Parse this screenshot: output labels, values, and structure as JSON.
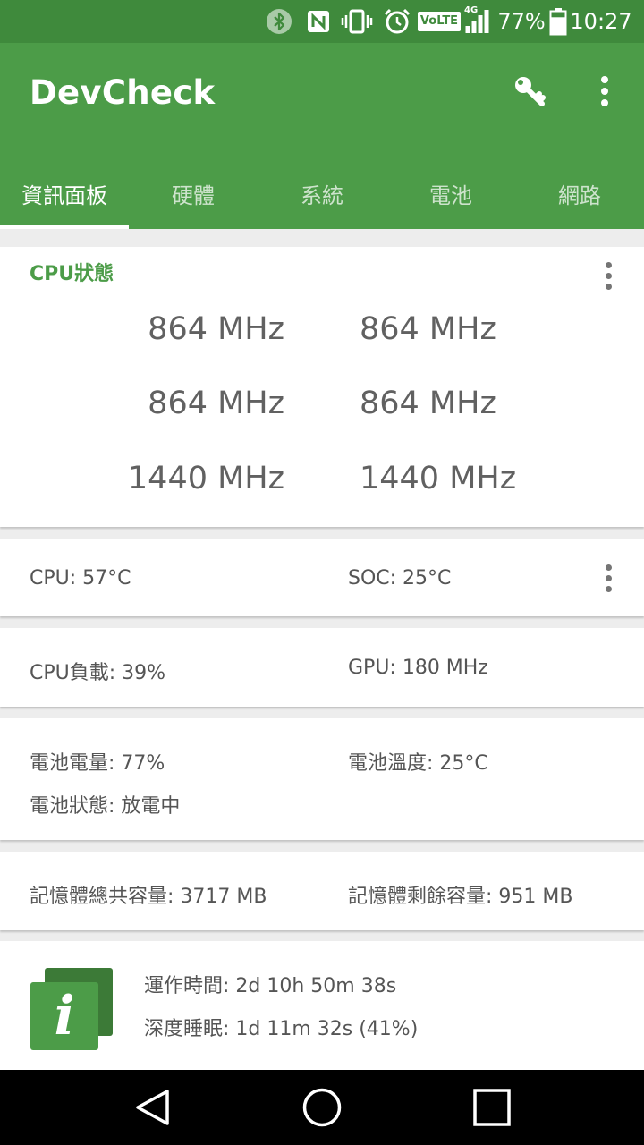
{
  "status_bar": {
    "battery_percent": "77%",
    "time": "10:27",
    "volte_label": "VoLTE",
    "network_label": "4G",
    "battery_level": 0.77
  },
  "app_bar": {
    "title": "DevCheck",
    "tabs": [
      {
        "label": "資訊面板",
        "active": true
      },
      {
        "label": "硬體"
      },
      {
        "label": "系統"
      },
      {
        "label": "電池"
      },
      {
        "label": "網路"
      }
    ]
  },
  "cpu_card": {
    "title": "CPU狀態",
    "frequencies": [
      "864 MHz",
      "864 MHz",
      "864 MHz",
      "864 MHz",
      "1440 MHz",
      "1440 MHz"
    ]
  },
  "temp_card": {
    "cpu_temp": "CPU: 57°C",
    "soc_temp": "SOC: 25°C"
  },
  "load_card": {
    "cpu_load": "CPU負載: 39%",
    "gpu_freq": "GPU: 180 MHz"
  },
  "battery_card": {
    "level": "電池電量: 77%",
    "temperature": "電池溫度: 25°C",
    "status": "電池狀態: 放電中"
  },
  "memory_card": {
    "total": "記憶體總共容量: 3717 MB",
    "free": "記憶體剩餘容量: 951 MB"
  },
  "uptime_card": {
    "icon_letter": "i",
    "uptime": "運作時間: 2d 10h 50m 38s",
    "deep_sleep": "深度睡眠: 1d 11m 32s (41%)"
  },
  "colors": {
    "status_bar": "#3f8a3c",
    "primary": "#4c9c48",
    "accent_text": "#4c9c48"
  }
}
